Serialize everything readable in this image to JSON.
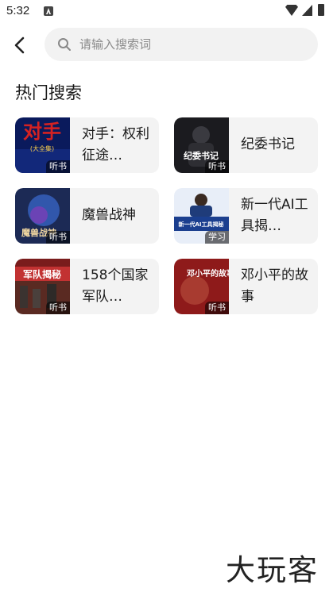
{
  "status_bar": {
    "time": "5:32",
    "icons": [
      "notification-icon",
      "wifi-icon",
      "signal-icon",
      "battery-icon"
    ]
  },
  "header": {
    "back_icon": "chevron-left-icon",
    "search": {
      "placeholder": "请输入搜索词",
      "value": "",
      "icon": "search-icon"
    }
  },
  "section": {
    "title": "热门搜索"
  },
  "items": [
    {
      "title": "对手：权利征途…",
      "badge": "听书",
      "cover_text": "对手",
      "cover_sub": "(大全集)"
    },
    {
      "title": "纪委书记",
      "badge": "听书",
      "cover_text": "纪委书记"
    },
    {
      "title": "魔兽战神",
      "badge": "听书",
      "cover_text": "魔兽战神"
    },
    {
      "title": "新一代AI工具揭…",
      "badge": "学习",
      "cover_text": "新一代AI工具揭秘"
    },
    {
      "title": "158个国家军队…",
      "badge": "听书",
      "cover_text": "军队揭秘"
    },
    {
      "title": "邓小平的故事",
      "badge": "听书",
      "cover_text": "邓小平的故事"
    }
  ],
  "watermark": "大玩客",
  "colors": {
    "card_bg": "#f3f3f3",
    "search_bg": "#f2f2f2",
    "text": "#1a1a1a"
  }
}
